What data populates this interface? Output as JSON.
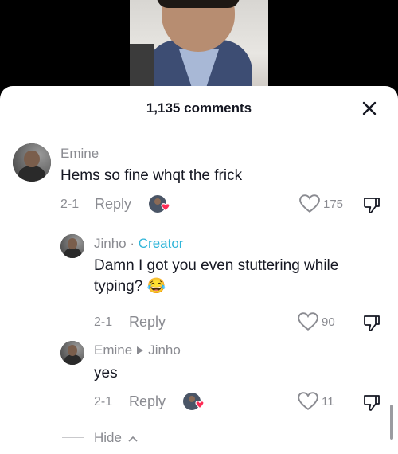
{
  "header": {
    "comment_count": "1,135 comments"
  },
  "comments": [
    {
      "author": "Emine",
      "text": "Hems so fine whqt the frick",
      "date": "2-1",
      "reply_label": "Reply",
      "likes": "175"
    },
    {
      "author": "Jinho",
      "separator": "·",
      "badge": "Creator",
      "text": "Damn I got you even stuttering while typing? 😂",
      "date": "2-1",
      "reply_label": "Reply",
      "likes": "90"
    },
    {
      "author": "Emine",
      "reply_to": "Jinho",
      "text": "yes",
      "date": "2-1",
      "reply_label": "Reply",
      "likes": "11"
    }
  ],
  "footer": {
    "hide_label": "Hide"
  },
  "colors": {
    "accent_creator": "#2fb5d9",
    "heart_badge": "#fe2c55",
    "muted": "#8a8b91"
  },
  "icons": [
    "close-icon",
    "heart-icon",
    "dislike-icon",
    "creator-liked-icon",
    "reply-arrow-icon",
    "chevron-up-icon"
  ]
}
